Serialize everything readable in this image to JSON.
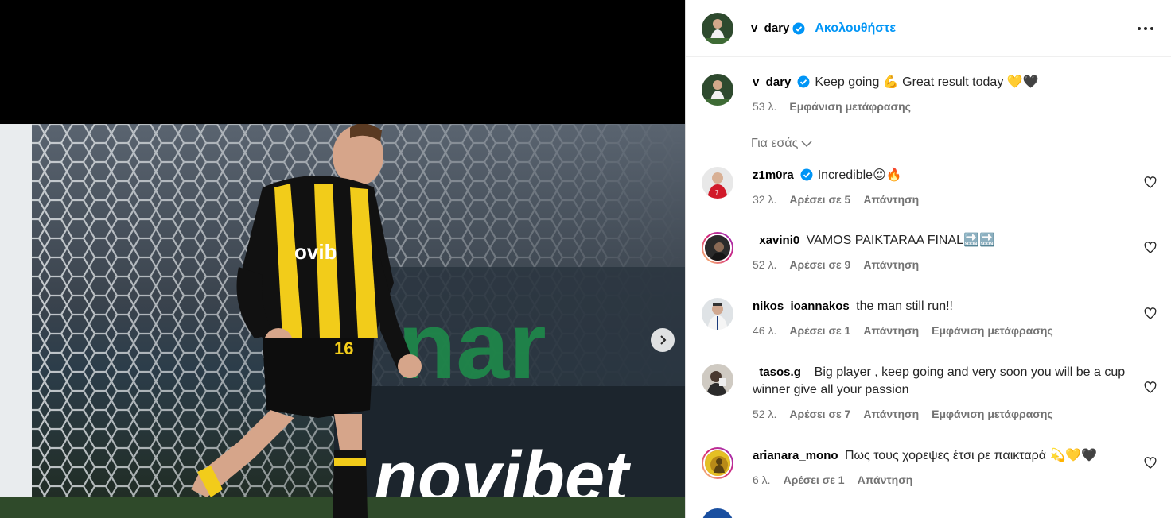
{
  "post": {
    "author": "v_dary",
    "follow_label": "Ακολουθήστε",
    "caption": "Keep going 💪 Great result today 💛🖤",
    "caption_time": "53 λ.",
    "caption_translate": "Εμφάνιση μετάφρασης"
  },
  "media": {
    "ad_text": "novibet",
    "ad_text_small": "nar"
  },
  "for_you_label": "Για εσάς",
  "comments": [
    {
      "user": "z1m0ra",
      "verified": true,
      "text": "Incredible😍🔥",
      "time": "32 λ.",
      "likes": "Αρέσει σε 5",
      "reply": "Απάντηση",
      "translate": ""
    },
    {
      "user": "_xavini0",
      "verified": false,
      "text": "VAMOS PAIKTARAA FINAL🔜🔜",
      "time": "52 λ.",
      "likes": "Αρέσει σε 9",
      "reply": "Απάντηση",
      "translate": ""
    },
    {
      "user": "nikos_ioannakos",
      "verified": false,
      "text": "the man still run!!",
      "time": "46 λ.",
      "likes": "Αρέσει σε 1",
      "reply": "Απάντηση",
      "translate": "Εμφάνιση μετάφρασης"
    },
    {
      "user": "_tasos.g_",
      "verified": false,
      "text": "Big player , keep going and very soon you will be a cup winner give all your passion",
      "time": "52 λ.",
      "likes": "Αρέσει σε 7",
      "reply": "Απάντηση",
      "translate": "Εμφάνιση μετάφρασης"
    },
    {
      "user": "arianara_mono",
      "verified": false,
      "text": "Πως τους χορεψες έτσι ρε παικταρά 💫💛🖤",
      "time": "6 λ.",
      "likes": "Αρέσει σε 1",
      "reply": "Απάντηση",
      "translate": ""
    }
  ],
  "colors": {
    "link": "#0095f6",
    "muted": "#737373",
    "text": "#262626"
  }
}
